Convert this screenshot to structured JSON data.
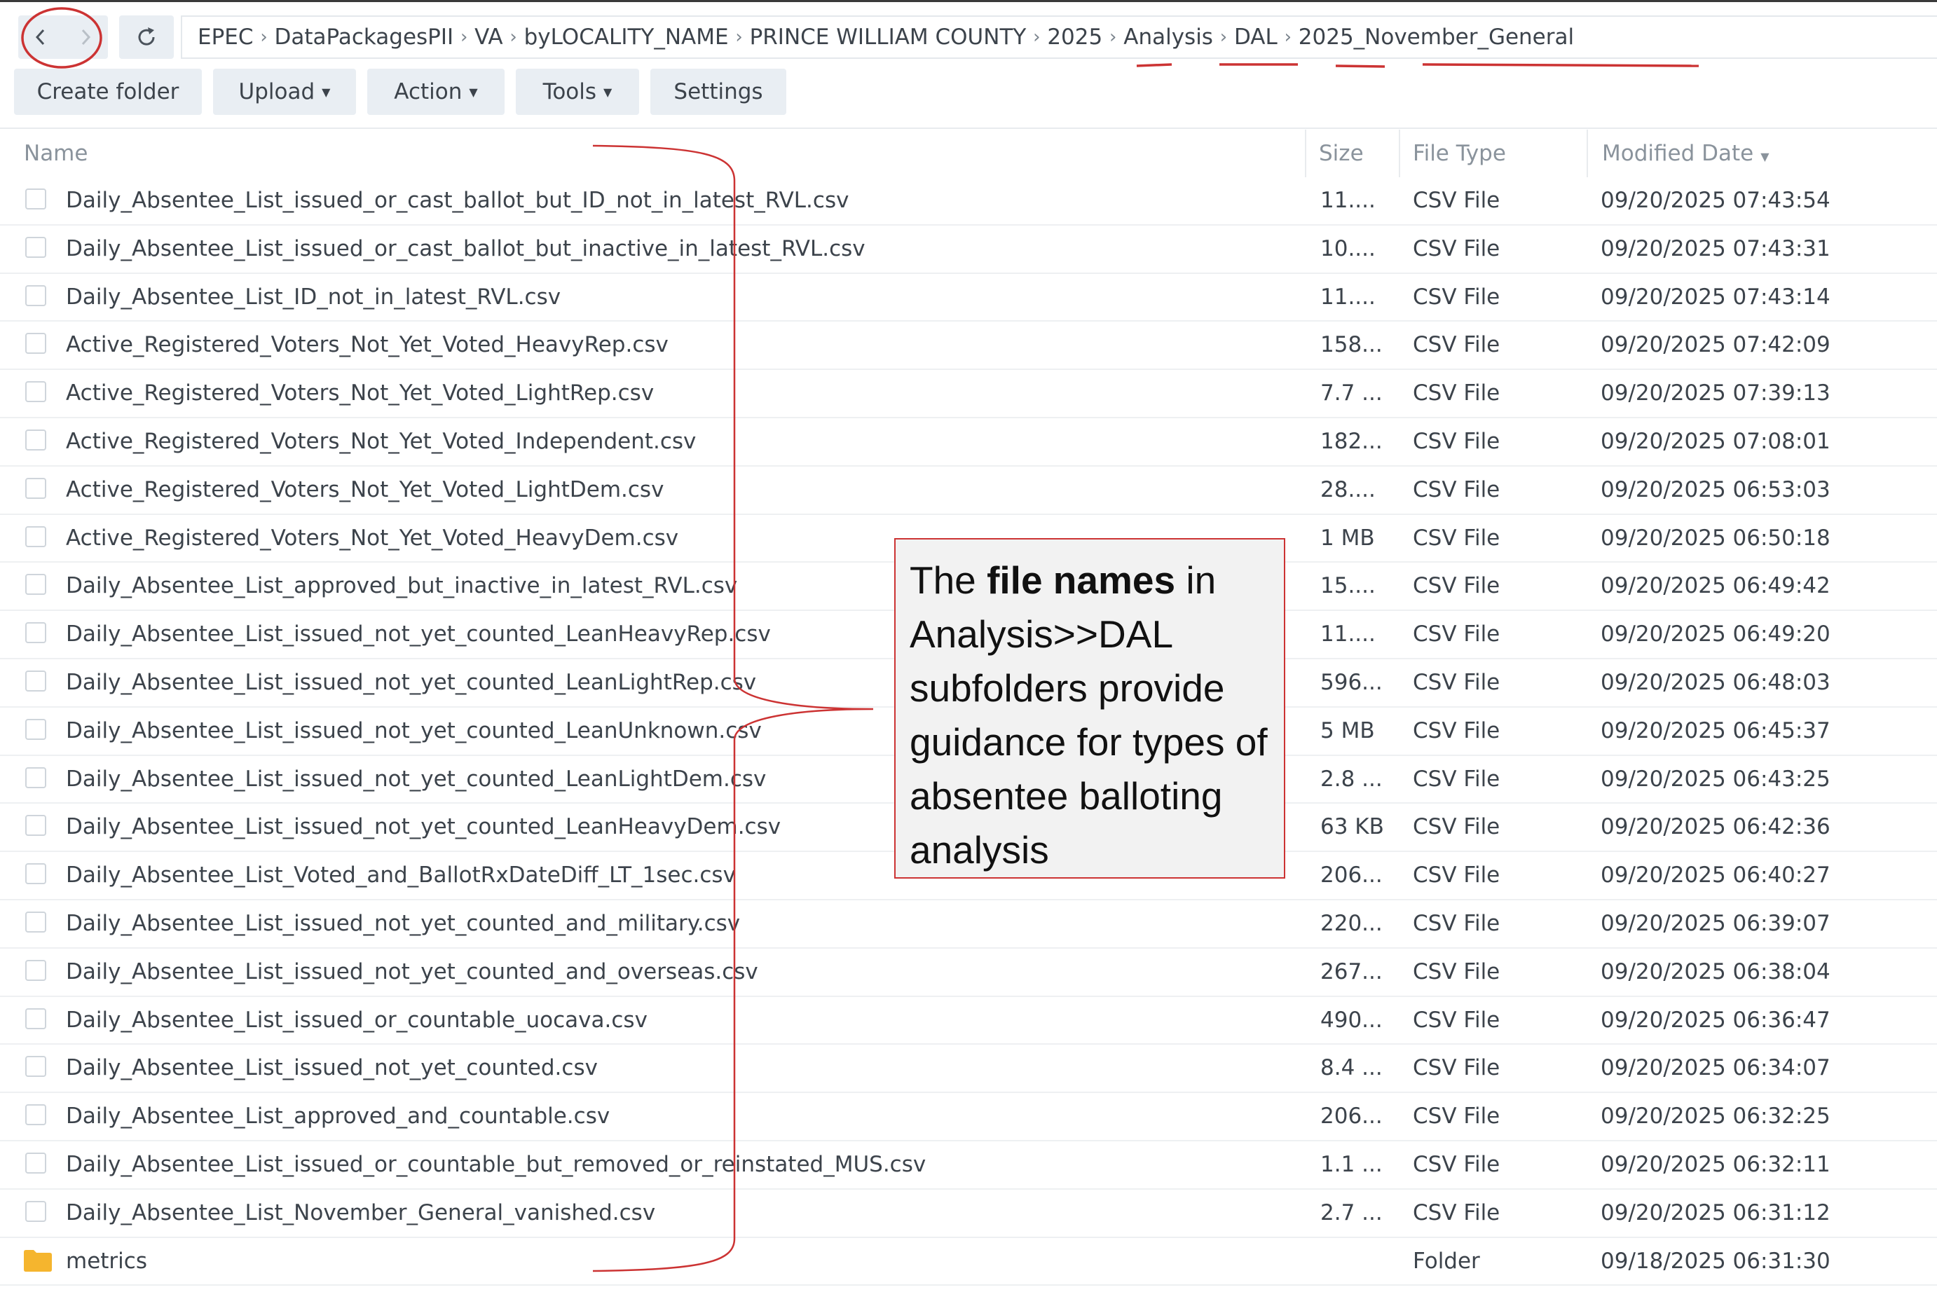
{
  "breadcrumb": [
    "EPEC",
    "DataPackagesPII",
    "VA",
    "byLOCALITY_NAME",
    "PRINCE WILLIAM COUNTY",
    "2025",
    "Analysis",
    "DAL",
    "2025_November_General"
  ],
  "toolbar": {
    "create_folder": "Create folder",
    "upload": "Upload",
    "action": "Action",
    "tools": "Tools",
    "settings": "Settings"
  },
  "columns": {
    "name": "Name",
    "size": "Size",
    "type": "File Type",
    "modified": "Modified Date"
  },
  "files": [
    {
      "name": "Daily_Absentee_List_issued_or_cast_ballot_but_ID_not_in_latest_RVL.csv",
      "size": "11....",
      "type": "CSV File",
      "modified": "09/20/2025 07:43:54"
    },
    {
      "name": "Daily_Absentee_List_issued_or_cast_ballot_but_inactive_in_latest_RVL.csv",
      "size": "10....",
      "type": "CSV File",
      "modified": "09/20/2025 07:43:31"
    },
    {
      "name": "Daily_Absentee_List_ID_not_in_latest_RVL.csv",
      "size": "11....",
      "type": "CSV File",
      "modified": "09/20/2025 07:43:14"
    },
    {
      "name": "Active_Registered_Voters_Not_Yet_Voted_HeavyRep.csv",
      "size": "158...",
      "type": "CSV File",
      "modified": "09/20/2025 07:42:09"
    },
    {
      "name": "Active_Registered_Voters_Not_Yet_Voted_LightRep.csv",
      "size": "7.7 ...",
      "type": "CSV File",
      "modified": "09/20/2025 07:39:13"
    },
    {
      "name": "Active_Registered_Voters_Not_Yet_Voted_Independent.csv",
      "size": "182...",
      "type": "CSV File",
      "modified": "09/20/2025 07:08:01"
    },
    {
      "name": "Active_Registered_Voters_Not_Yet_Voted_LightDem.csv",
      "size": "28....",
      "type": "CSV File",
      "modified": "09/20/2025 06:53:03"
    },
    {
      "name": "Active_Registered_Voters_Not_Yet_Voted_HeavyDem.csv",
      "size": "1 MB",
      "type": "CSV File",
      "modified": "09/20/2025 06:50:18"
    },
    {
      "name": "Daily_Absentee_List_approved_but_inactive_in_latest_RVL.csv",
      "size": "15....",
      "type": "CSV File",
      "modified": "09/20/2025 06:49:42"
    },
    {
      "name": "Daily_Absentee_List_issued_not_yet_counted_LeanHeavyRep.csv",
      "size": "11....",
      "type": "CSV File",
      "modified": "09/20/2025 06:49:20"
    },
    {
      "name": "Daily_Absentee_List_issued_not_yet_counted_LeanLightRep.csv",
      "size": "596...",
      "type": "CSV File",
      "modified": "09/20/2025 06:48:03"
    },
    {
      "name": "Daily_Absentee_List_issued_not_yet_counted_LeanUnknown.csv",
      "size": "5 MB",
      "type": "CSV File",
      "modified": "09/20/2025 06:45:37"
    },
    {
      "name": "Daily_Absentee_List_issued_not_yet_counted_LeanLightDem.csv",
      "size": "2.8 ...",
      "type": "CSV File",
      "modified": "09/20/2025 06:43:25"
    },
    {
      "name": "Daily_Absentee_List_issued_not_yet_counted_LeanHeavyDem.csv",
      "size": "63 KB",
      "type": "CSV File",
      "modified": "09/20/2025 06:42:36"
    },
    {
      "name": "Daily_Absentee_List_Voted_and_BallotRxDateDiff_LT_1sec.csv",
      "size": "206...",
      "type": "CSV File",
      "modified": "09/20/2025 06:40:27"
    },
    {
      "name": "Daily_Absentee_List_issued_not_yet_counted_and_military.csv",
      "size": "220...",
      "type": "CSV File",
      "modified": "09/20/2025 06:39:07"
    },
    {
      "name": "Daily_Absentee_List_issued_not_yet_counted_and_overseas.csv",
      "size": "267...",
      "type": "CSV File",
      "modified": "09/20/2025 06:38:04"
    },
    {
      "name": "Daily_Absentee_List_issued_or_countable_uocava.csv",
      "size": "490...",
      "type": "CSV File",
      "modified": "09/20/2025 06:36:47"
    },
    {
      "name": "Daily_Absentee_List_issued_not_yet_counted.csv",
      "size": "8.4 ...",
      "type": "CSV File",
      "modified": "09/20/2025 06:34:07"
    },
    {
      "name": "Daily_Absentee_List_approved_and_countable.csv",
      "size": "206...",
      "type": "CSV File",
      "modified": "09/20/2025 06:32:25"
    },
    {
      "name": "Daily_Absentee_List_issued_or_countable_but_removed_or_reinstated_MUS.csv",
      "size": "1.1 ...",
      "type": "CSV File",
      "modified": "09/20/2025 06:32:11"
    },
    {
      "name": "Daily_Absentee_List_November_General_vanished.csv",
      "size": "2.7 ...",
      "type": "CSV File",
      "modified": "09/20/2025 06:31:12"
    },
    {
      "name": "metrics",
      "size": "",
      "type": "Folder",
      "modified": "09/18/2025 06:31:30",
      "is_folder": true
    }
  ],
  "annotation": {
    "pre": "The ",
    "bold": "file names",
    "post": " in Analysis>>DAL subfolders provide guidance for types of absentee balloting analysis"
  },
  "colors": {
    "annotation_red": "#cc3333",
    "folder_yellow": "#f5b52e",
    "button_bg": "#e9eef3"
  }
}
